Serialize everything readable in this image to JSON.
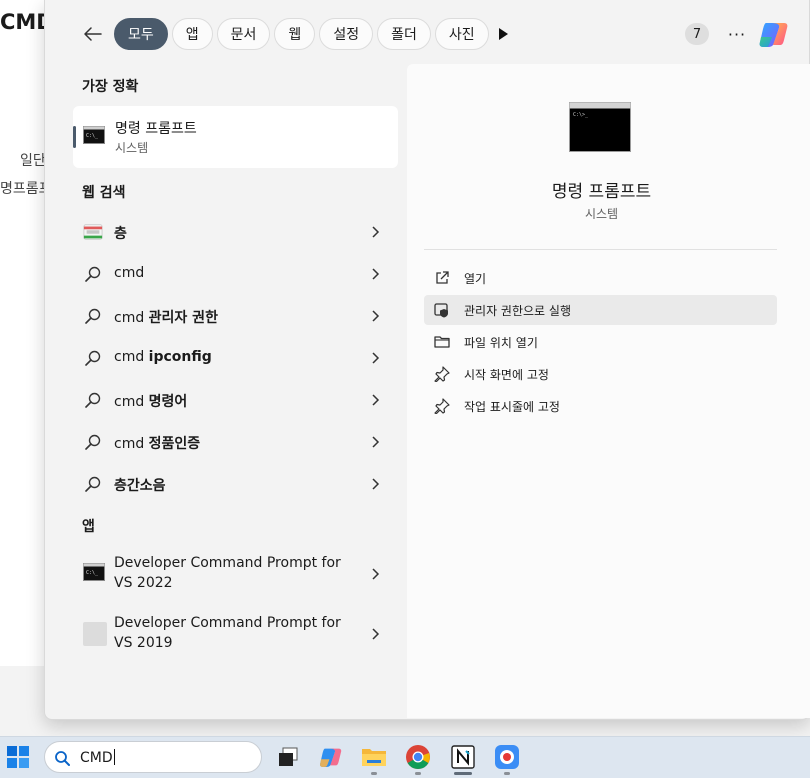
{
  "background_doc": {
    "title": "CMD",
    "line1": "일단",
    "line2": "명프롬프"
  },
  "filters": {
    "chips": [
      {
        "label": "모두",
        "active": true
      },
      {
        "label": "앱",
        "active": false
      },
      {
        "label": "문서",
        "active": false
      },
      {
        "label": "웹",
        "active": false
      },
      {
        "label": "설정",
        "active": false
      },
      {
        "label": "폴더",
        "active": false
      },
      {
        "label": "사진",
        "active": false
      }
    ],
    "count": "7",
    "more": "···"
  },
  "best_match": {
    "heading": "가장 정확",
    "name": "명령 프롬프트",
    "subtitle": "시스템"
  },
  "web_search": {
    "heading": "웹 검색",
    "items": [
      {
        "prefix": "",
        "bold": "층",
        "icon": "web-image-icon"
      },
      {
        "prefix": "cmd",
        "bold": "",
        "icon": "search-icon"
      },
      {
        "prefix": "cmd ",
        "bold": "관리자 권한",
        "icon": "search-icon"
      },
      {
        "prefix": "cmd ",
        "bold": "ipconfig",
        "icon": "search-icon"
      },
      {
        "prefix": "cmd ",
        "bold": "명령어",
        "icon": "search-icon"
      },
      {
        "prefix": "cmd ",
        "bold": "정품인증",
        "icon": "search-icon"
      },
      {
        "prefix": "",
        "bold": "층간소음",
        "icon": "search-icon"
      }
    ]
  },
  "apps": {
    "heading": "앱",
    "items": [
      {
        "label": "Developer Command Prompt for VS 2022",
        "icon": "console-icon"
      },
      {
        "label": "Developer Command Prompt for VS 2019",
        "icon": "blank-app-icon"
      }
    ]
  },
  "detail": {
    "name": "명령 프롬프트",
    "subtitle": "시스템",
    "actions": [
      {
        "label": "열기",
        "icon": "open-external-icon",
        "highlighted": false
      },
      {
        "label": "관리자 권한으로 실행",
        "icon": "shield-icon",
        "highlighted": true
      },
      {
        "label": "파일 위치 열기",
        "icon": "folder-icon",
        "highlighted": false
      },
      {
        "label": "시작 화면에 고정",
        "icon": "pin-icon",
        "highlighted": false
      },
      {
        "label": "작업 표시줄에 고정",
        "icon": "pin-icon",
        "highlighted": false
      }
    ]
  },
  "taskbar": {
    "search_value": "CMD",
    "apps": [
      "task-view-icon",
      "copilot-icon",
      "file-explorer-icon",
      "chrome-icon",
      "notion-icon",
      "screen-recorder-icon"
    ]
  }
}
